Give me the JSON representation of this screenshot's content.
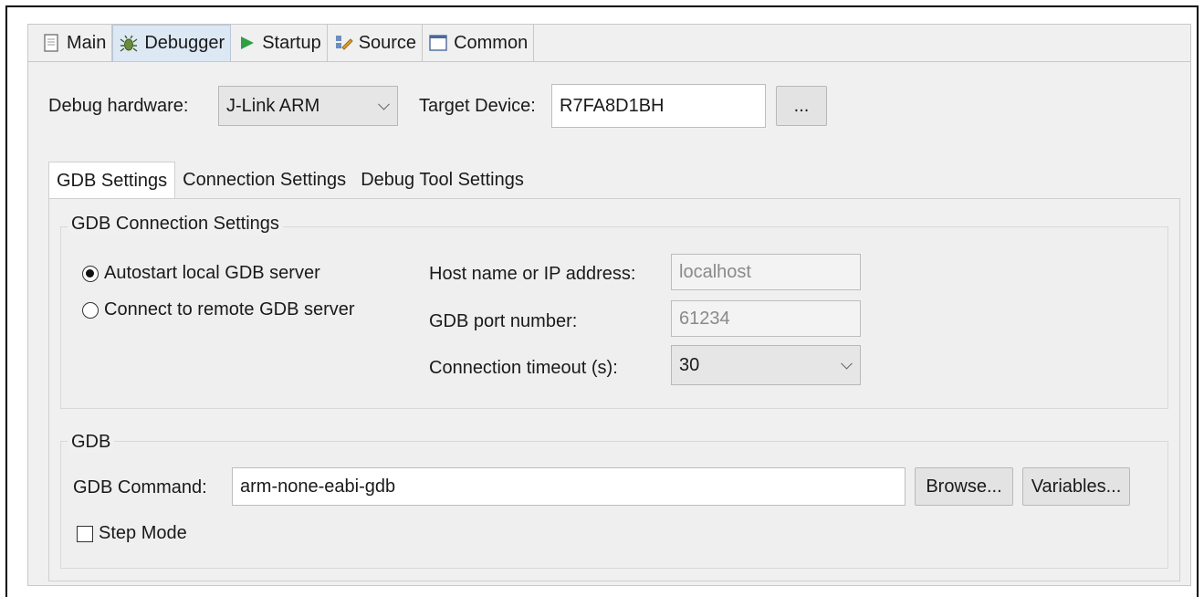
{
  "tabs": [
    "Main",
    "Debugger",
    "Startup",
    "Source",
    "Common"
  ],
  "debug_hardware": {
    "label": "Debug hardware:",
    "value": "J-Link ARM"
  },
  "target_device": {
    "label": "Target Device:",
    "value": "R7FA8D1BH",
    "browse_label": "..."
  },
  "inner_tabs": [
    "GDB Settings",
    "Connection Settings",
    "Debug Tool Settings"
  ],
  "gdb_connection": {
    "title": "GDB Connection Settings",
    "radio_autostart": "Autostart local GDB server",
    "radio_remote": "Connect to remote GDB server",
    "selected": "Autostart local GDB server",
    "host_label": "Host name or IP address:",
    "host_value": "localhost",
    "port_label": "GDB port number:",
    "port_value": "61234",
    "timeout_label": "Connection timeout (s):",
    "timeout_value": "30"
  },
  "gdb": {
    "title": "GDB",
    "command_label": "GDB Command:",
    "command_value": "arm-none-eabi-gdb",
    "browse_label": "Browse...",
    "variables_label": "Variables...",
    "step_mode_label": "Step Mode",
    "step_mode_checked": false
  },
  "colors": {
    "active_tab_bg": "#dde8f5",
    "panel_bg": "#f0f0f0",
    "startup_icon": "#2ea043"
  }
}
